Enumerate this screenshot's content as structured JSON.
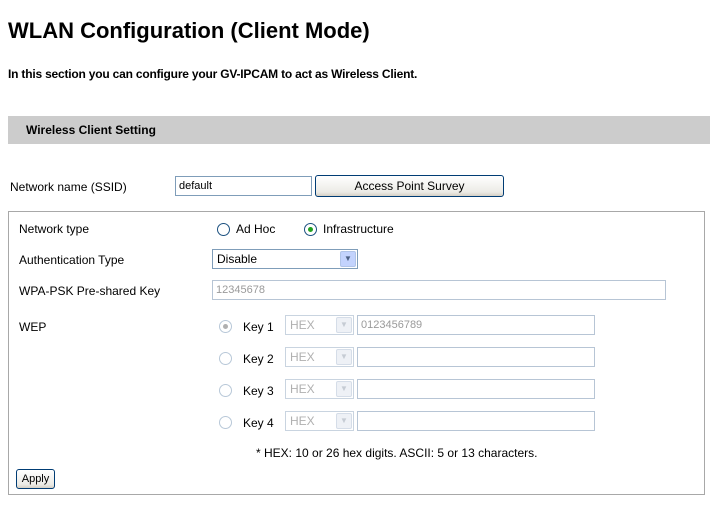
{
  "page": {
    "title": "WLAN Configuration (Client Mode)",
    "intro": "In this section you can configure your GV-IPCAM to act as Wireless Client."
  },
  "section": {
    "title": "Wireless Client Setting"
  },
  "ssid": {
    "label": "Network name (SSID)",
    "value": "default",
    "survey_button": "Access Point Survey"
  },
  "network_type": {
    "label": "Network type",
    "options": [
      "Ad Hoc",
      "Infrastructure"
    ],
    "selected": "Infrastructure"
  },
  "auth": {
    "label": "Authentication Type",
    "value": "Disable"
  },
  "wpa": {
    "label": "WPA-PSK Pre-shared Key",
    "value": "12345678"
  },
  "wep": {
    "label": "WEP",
    "selected_key": "Key 1",
    "keys": [
      {
        "label": "Key 1",
        "format": "HEX",
        "value": "0123456789"
      },
      {
        "label": "Key 2",
        "format": "HEX",
        "value": ""
      },
      {
        "label": "Key 3",
        "format": "HEX",
        "value": ""
      },
      {
        "label": "Key 4",
        "format": "HEX",
        "value": ""
      }
    ],
    "note": "* HEX: 10 or 26 hex digits. ASCII: 5 or 13 characters."
  },
  "apply_button": "Apply"
}
